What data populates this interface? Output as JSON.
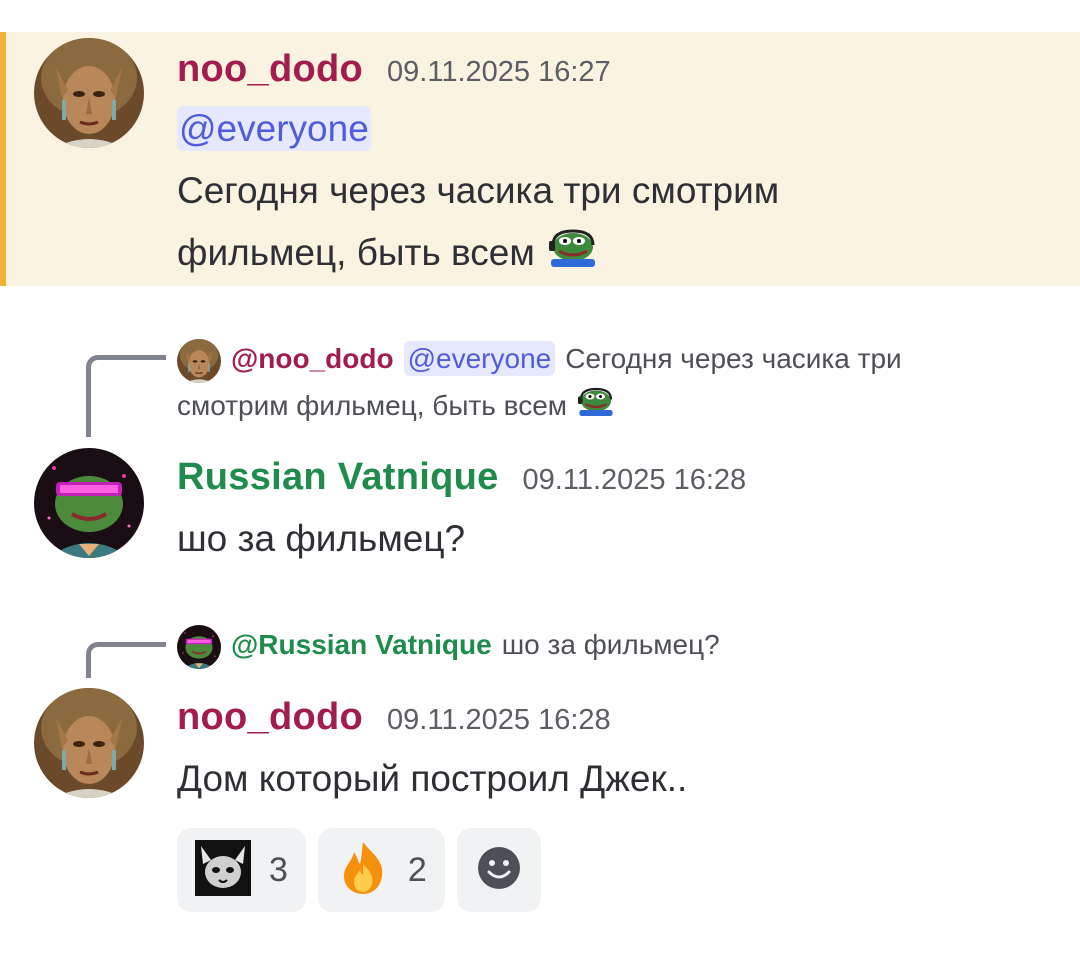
{
  "messages": [
    {
      "username": "noo_dodo",
      "timestamp": "09.11.2025 16:27",
      "mention": "@everyone",
      "line1": "Сегодня через часика три смотрим",
      "line2": "фильмец, быть всем"
    },
    {
      "reply": {
        "username": "@noo_dodo",
        "mention": "@everyone",
        "text1": "Сегодня через часика три",
        "text2": "смотрим фильмец, быть всем"
      },
      "username": "Russian Vatnique",
      "timestamp": "09.11.2025 16:28",
      "text": "шо за фильмец?"
    },
    {
      "reply": {
        "username": "@Russian Vatnique",
        "text": "шо за фильмец?"
      },
      "username": "noo_dodo",
      "timestamp": "09.11.2025 16:28",
      "text": "Дом который построил Джек.."
    }
  ],
  "reactions": [
    {
      "icon": "cat-meme-emoji",
      "count": "3"
    },
    {
      "icon": "fire-emoji",
      "count": "2"
    },
    {
      "icon": "add-reaction-icon"
    }
  ],
  "colors": {
    "highlight_bg": "#fbf3e1",
    "highlight_bar": "#f0b232",
    "dodo_name": "#a31c4f",
    "vatnique_name": "#1f8b4c",
    "mention_text": "#505cdc",
    "mention_bg": "#e6e8fd"
  }
}
